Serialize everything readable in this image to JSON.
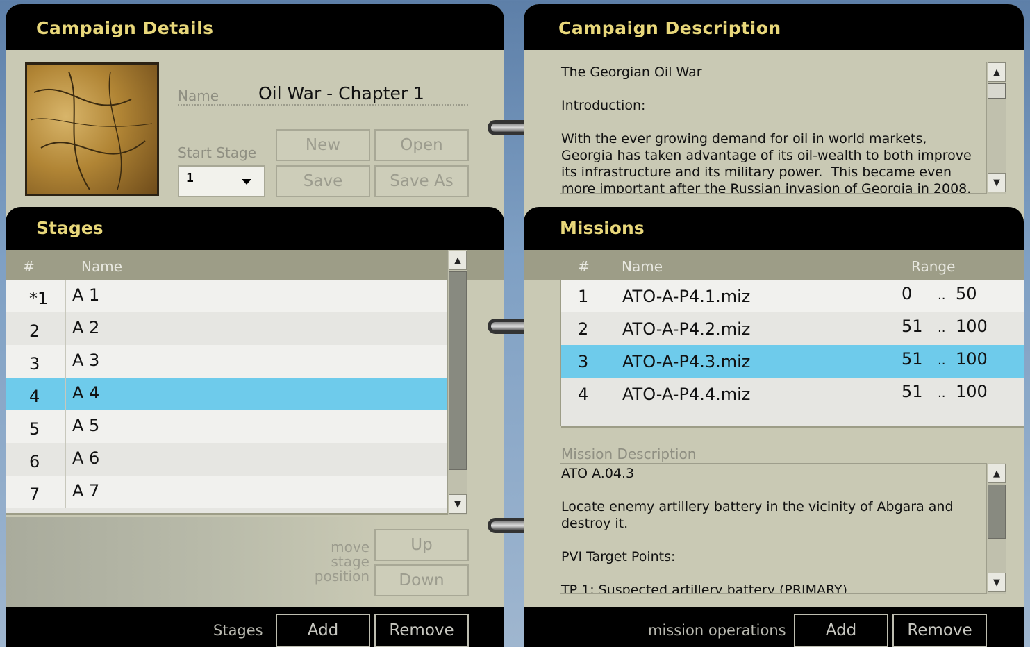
{
  "campaign_details": {
    "title": "Campaign Details",
    "name_label": "Name",
    "name_value": "Oil War - Chapter 1",
    "start_stage_label": "Start Stage",
    "start_stage_value": "1",
    "buttons": {
      "new": "New",
      "open": "Open",
      "save": "Save",
      "save_as": "Save As"
    }
  },
  "campaign_description": {
    "title": "Campaign Description",
    "text": "The Georgian Oil War\n\nIntroduction:\n\nWith the ever growing demand for oil in world markets,\nGeorgia has taken advantage of its oil-wealth to both improve\nits infrastructure and its military power.  This became even\nmore important after the Russian invasion of Georgia in 2008."
  },
  "stages": {
    "title": "Stages",
    "columns": {
      "num": "#",
      "name": "Name"
    },
    "rows": [
      {
        "num": "*1",
        "name": "A 1"
      },
      {
        "num": "2",
        "name": "A 2"
      },
      {
        "num": "3",
        "name": "A 3"
      },
      {
        "num": "4",
        "name": "A 4"
      },
      {
        "num": "5",
        "name": "A 5"
      },
      {
        "num": "6",
        "name": "A 6"
      },
      {
        "num": "7",
        "name": "A 7"
      }
    ],
    "selected_index": 3,
    "move_label": "move\nstage\nposition",
    "up": "Up",
    "down": "Down",
    "footer_label": "Stages",
    "add": "Add",
    "remove": "Remove"
  },
  "missions": {
    "title": "Missions",
    "columns": {
      "num": "#",
      "name": "Name",
      "range": "Range"
    },
    "rows": [
      {
        "num": "1",
        "name": "ATO-A-P4.1.miz",
        "from": "0",
        "sep": "..",
        "to": "50"
      },
      {
        "num": "2",
        "name": "ATO-A-P4.2.miz",
        "from": "51",
        "sep": "..",
        "to": "100"
      },
      {
        "num": "3",
        "name": "ATO-A-P4.3.miz",
        "from": "51",
        "sep": "..",
        "to": "100"
      },
      {
        "num": "4",
        "name": "ATO-A-P4.4.miz",
        "from": "51",
        "sep": "..",
        "to": "100"
      }
    ],
    "selected_index": 2,
    "description_label": "Mission Description",
    "description_text": "ATO A.04.3\n\nLocate enemy artillery battery in the vicinity of Abgara and\ndestroy it.\n\nPVI Target Points:\n\nTP 1: Suspected artillery battery (PRIMARY)",
    "footer_label": "mission operations",
    "add": "Add",
    "remove": "Remove"
  },
  "colors": {
    "header_text": "#e8d77a",
    "selection": "#6ecbeb",
    "panel_bg": "#c9c9b4"
  }
}
